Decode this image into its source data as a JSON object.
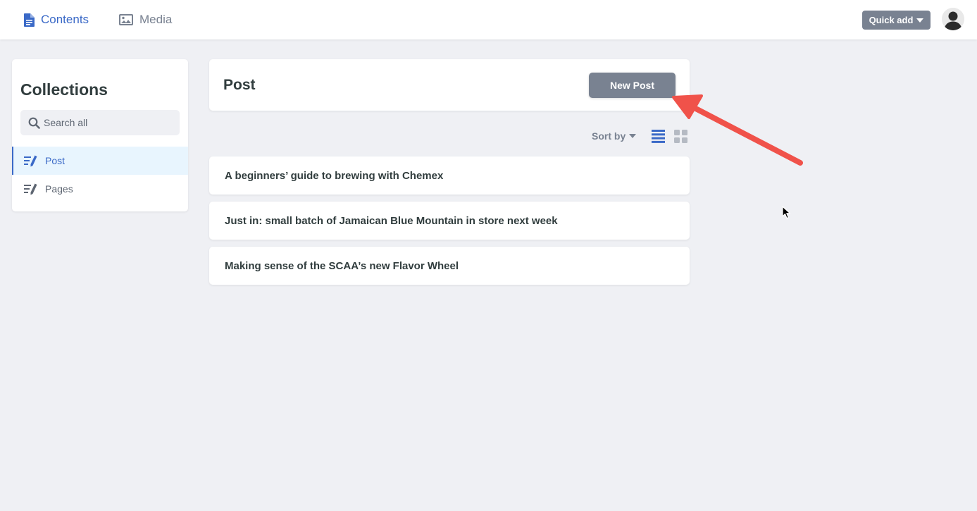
{
  "topbar": {
    "tabs": [
      {
        "label": "Contents",
        "icon": "document-icon",
        "active": true
      },
      {
        "label": "Media",
        "icon": "image-icon",
        "active": false
      }
    ],
    "quick_add_label": "Quick add"
  },
  "sidebar": {
    "title": "Collections",
    "search_placeholder": "Search all",
    "items": [
      {
        "label": "Post",
        "icon": "edit-list-icon",
        "active": true
      },
      {
        "label": "Pages",
        "icon": "edit-list-icon",
        "active": false
      }
    ]
  },
  "main": {
    "title": "Post",
    "new_button_label": "New Post",
    "sort_label": "Sort by",
    "view_mode": "list",
    "entries": [
      "A beginners’ guide to brewing with Chemex",
      "Just in: small batch of Jamaican Blue Mountain in store next week",
      "Making sense of the SCAA’s new Flavor Wheel"
    ]
  },
  "colors": {
    "accent": "#3a69c7",
    "button_gray": "#798291",
    "background": "#eff0f4",
    "annotation_arrow": "#f0524a"
  }
}
